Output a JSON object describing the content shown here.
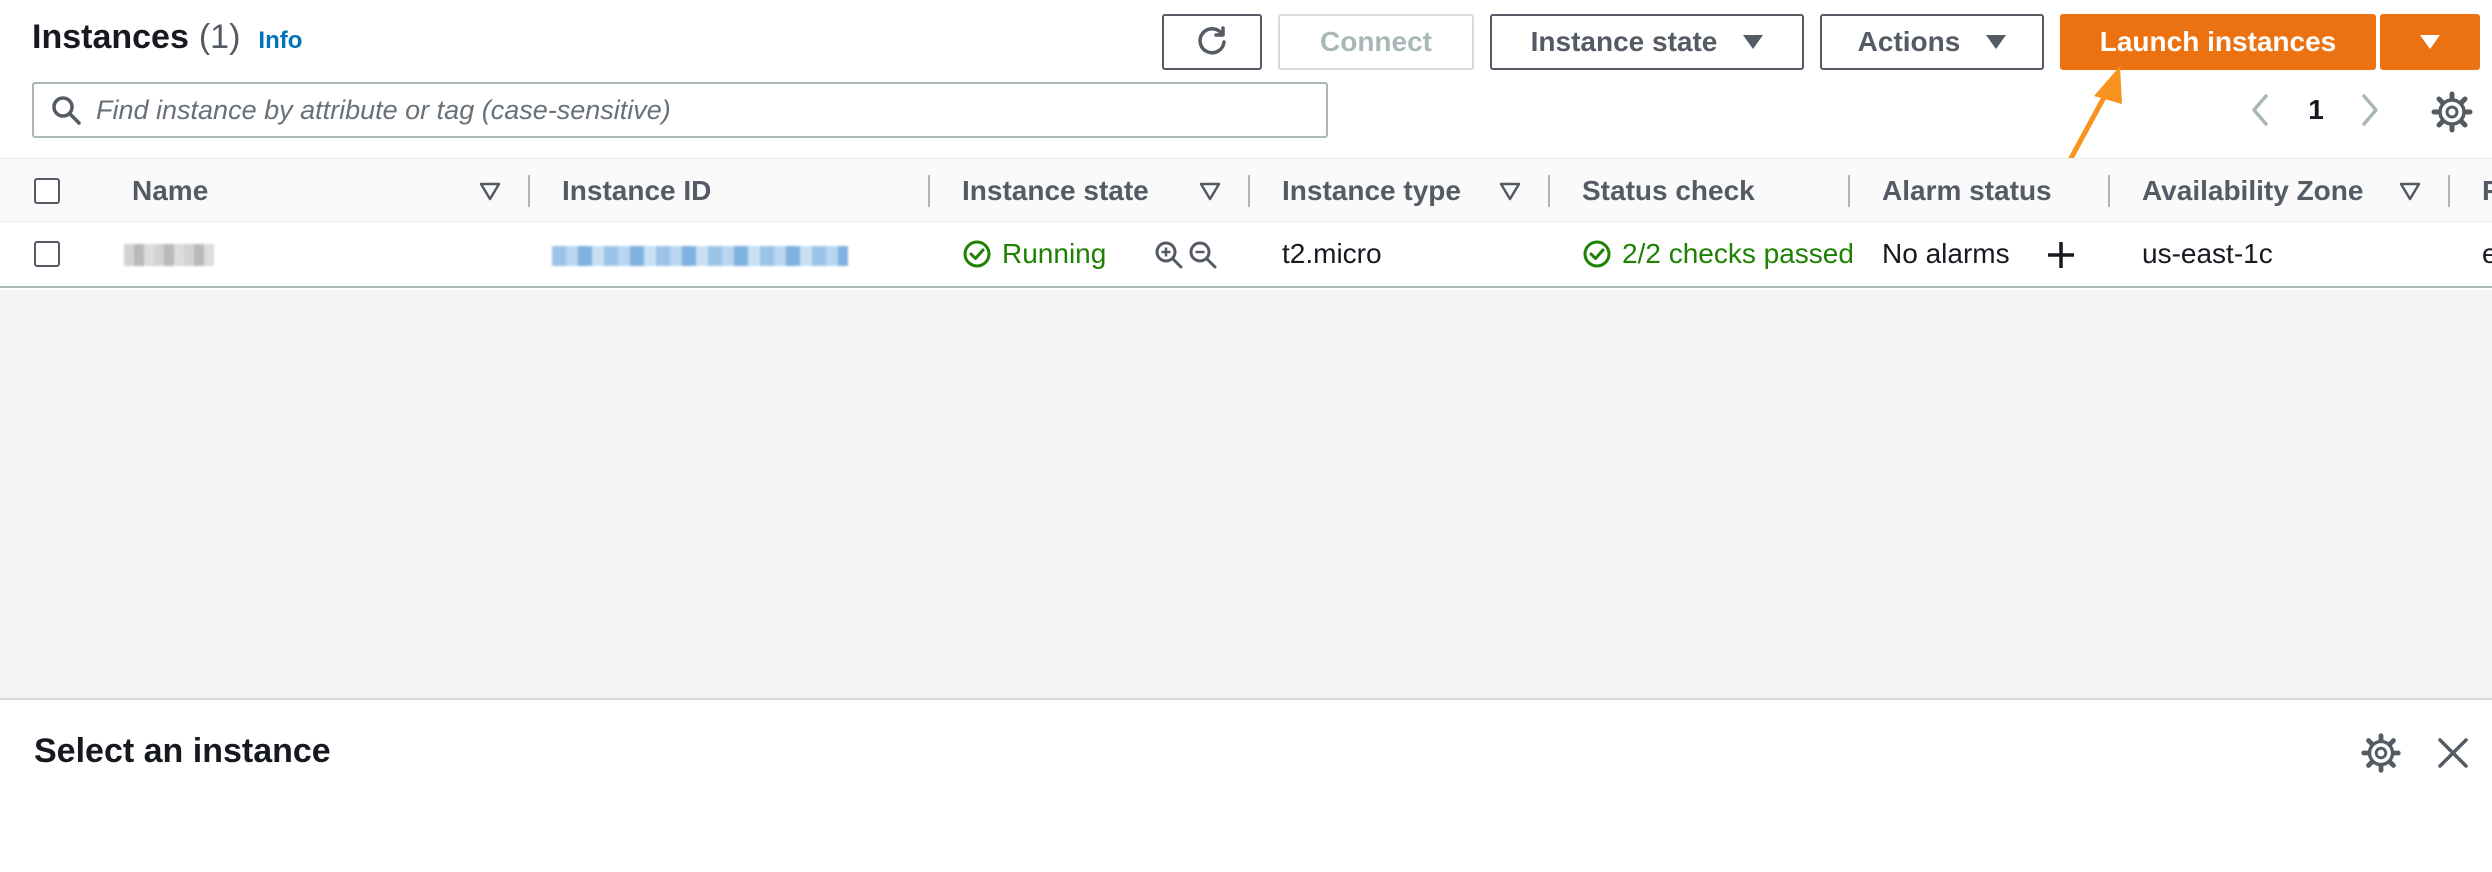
{
  "header": {
    "title": "Instances",
    "count": "(1)",
    "info_link": "Info",
    "buttons": {
      "refresh_icon": "refresh-icon",
      "connect": "Connect",
      "instance_state": "Instance state",
      "actions": "Actions",
      "launch": "Launch instances"
    },
    "search": {
      "placeholder": "Find instance by attribute or tag (case-sensitive)",
      "value": ""
    },
    "pagination": {
      "page": "1"
    }
  },
  "table": {
    "columns": [
      "Name",
      "Instance ID",
      "Instance state",
      "Instance type",
      "Status check",
      "Alarm status",
      "Availability Zone",
      "P"
    ],
    "rows": [
      {
        "name": "",
        "instance_id": "",
        "state": "Running",
        "type": "t2.micro",
        "status_check": "2/2 checks passed",
        "alarm_status": "No alarms",
        "zone": "us-east-1c",
        "extra": "e"
      }
    ]
  },
  "bottom_panel": {
    "title": "Select an instance"
  },
  "colors": {
    "accent_orange": "#ec7211",
    "link_blue": "#0073bb",
    "success_green": "#1d8102",
    "annotation_arrow": "#f7931e"
  }
}
